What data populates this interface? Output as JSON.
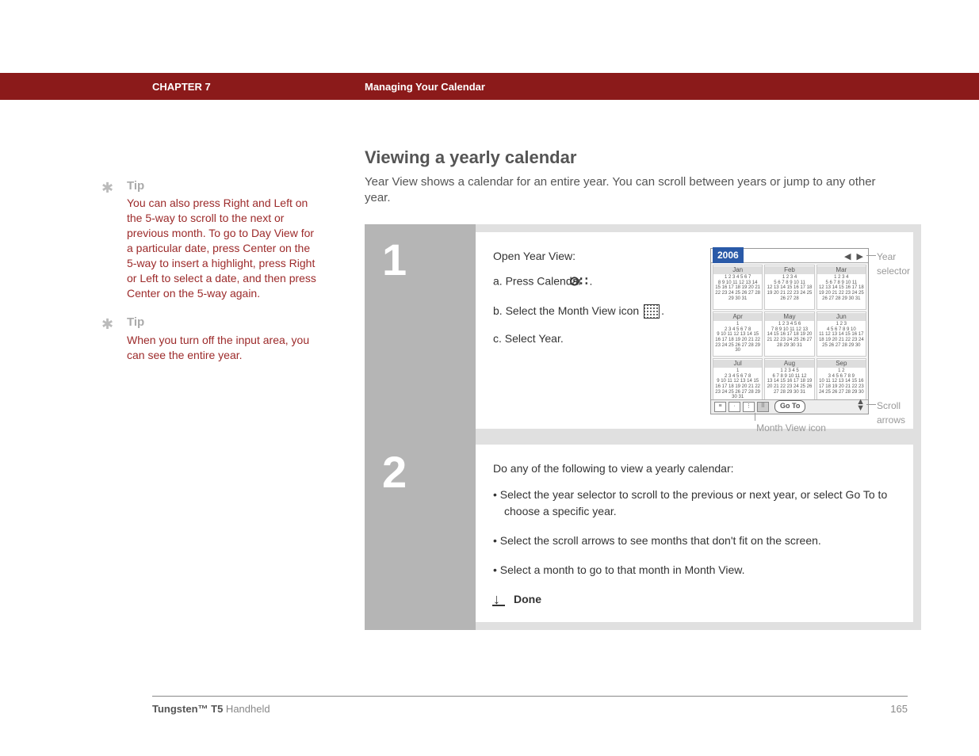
{
  "header": {
    "chapter": "CHAPTER 7",
    "title": "Managing Your Calendar"
  },
  "tips": [
    {
      "label": "Tip",
      "text": "You can also press Right and Left on the 5-way to scroll to the next or previous month. To go to Day View for a particular date, press Center on the 5-way to insert a highlight, press Right or Left to select a date, and then press Center on the 5-way again."
    },
    {
      "label": "Tip",
      "text": "When you turn off the input area, you can see the entire year."
    }
  ],
  "main": {
    "heading": "Viewing a yearly calendar",
    "intro": "Year View shows a calendar for an entire year. You can scroll between years or jump to any other year."
  },
  "step1": {
    "num": "1",
    "line1": "Open Year View:",
    "a": "a.  Press Calendar ",
    "a_suffix": ".",
    "b": "b.  Select the Month View icon ",
    "b_suffix": ".",
    "c": "c.  Select Year.",
    "annot_year_selector": "Year selector",
    "annot_scroll_arrows": "Scroll arrows",
    "annot_month_view": "Month View icon"
  },
  "calendar": {
    "year": "2006",
    "months": [
      "Jan",
      "Feb",
      "Mar",
      "Apr",
      "May",
      "Jun",
      "Jul",
      "Aug",
      "Sep"
    ],
    "month_days": [
      "1 2 3 4 5 6 7\n8 9 10 11 12 13 14\n15 16 17 18 19 20 21\n22 23 24 25 26 27 28\n29 30 31",
      "1 2 3 4\n5 6 7 8 9 10 11\n12 13 14 15 16 17 18\n19 20 21 22 23 24 25\n26 27 28",
      "1 2 3 4\n5 6 7 8 9 10 11\n12 13 14 15 16 17 18\n19 20 21 22 23 24 25\n26 27 28 29 30 31",
      "1\n2 3 4 5 6 7 8\n9 10 11 12 13 14 15\n16 17 18 19 20 21 22\n23 24 25 26 27 28 29\n30",
      "1 2 3 4 5 6\n7 8 9 10 11 12 13\n14 15 16 17 18 19 20\n21 22 23 24 25 26 27\n28 29 30 31",
      "1 2 3\n4 5 6 7 8 9 10\n11 12 13 14 15 16 17\n18 19 20 21 22 23 24\n25 26 27 28 29 30",
      "1\n2 3 4 5 6 7 8\n9 10 11 12 13 14 15\n16 17 18 19 20 21 22\n23 24 25 26 27 28 29\n30 31",
      "1 2 3 4 5\n6 7 8 9 10 11 12\n13 14 15 16 17 18 19\n20 21 22 23 24 25 26\n27 28 29 30 31",
      "1 2\n3 4 5 6 7 8 9\n10 11 12 13 14 15 16\n17 18 19 20 21 22 23\n24 25 26 27 28 29 30"
    ],
    "goto": "Go To"
  },
  "step2": {
    "num": "2",
    "line1": "Do any of the following to view a yearly calendar:",
    "b1": "Select the year selector to scroll to the previous or next year, or select Go To to choose a specific year.",
    "b2": "Select the scroll arrows to see months that don't fit on the screen.",
    "b3": "Select a month to go to that month in Month View.",
    "done": "Done"
  },
  "footer": {
    "product_bold": "Tungsten™ T5",
    "product_rest": " Handheld",
    "page": "165"
  }
}
